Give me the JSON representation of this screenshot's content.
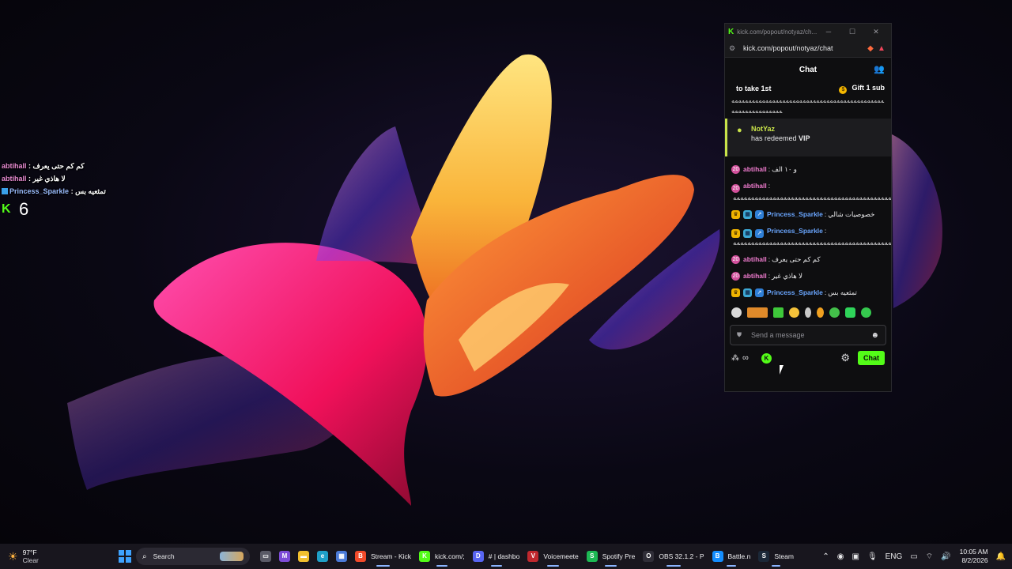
{
  "overlay": {
    "messages": [
      {
        "user": "abtihall",
        "text": "كم كم حتى يعرف"
      },
      {
        "user": "abtihall",
        "text": "لا هاذي غير"
      },
      {
        "user": "Princess_Sparkle",
        "text": "تمثعيه بس"
      }
    ],
    "viewer_count": "6"
  },
  "window": {
    "title": "kick.com/popout/notyaz/ch...",
    "url": "kick.com/popout/notyaz/chat",
    "controls": {
      "minimize": "─",
      "maximize": "☐",
      "close": "✕"
    }
  },
  "chat": {
    "header": "Chat",
    "pinned": {
      "left": "to take 1st",
      "gift": "Gift 1 sub"
    },
    "spam_top": "ﻪﻪﻪﻪﻪﻪﻪﻪﻪﻪﻪﻪﻪﻪﻪﻪﻪﻪﻪﻪﻪﻪﻪﻪﻪﻪﻪﻪﻪﻪﻪﻪﻪﻪﻪﻪﻪﻪﻪﻪﻪﻪﻪﻪﻪﻪﻪﻪﻪﻪﻪﻪﻪﻪﻪﻪﻪﻪﻪﻪ",
    "vip_event": {
      "user": "NotYaz",
      "text_prefix": "has redeemed ",
      "reward": "VIP"
    },
    "messages": [
      {
        "user": "abtihall",
        "text": "و ١٠ الف"
      },
      {
        "user": "abtihall",
        "text": "ﻪﻪﻪﻪﻪﻪﻪﻪﻪﻪﻪﻪﻪﻪﻪﻪﻪﻪﻪﻪﻪﻪﻪﻪﻪﻪﻪﻪﻪﻪﻪﻪﻪﻪﻪﻪﻪﻪﻪﻪﻪﻪﻪﻪﻪﻪﻪﻪﻪﻪ"
      },
      {
        "user": "Princess_Sparkle",
        "text": "خصوصيات شالي"
      },
      {
        "user": "Princess_Sparkle",
        "text": "ﻪﻪﻪﻪﻪﻪﻪﻪﻪﻪﻪﻪﻪﻪﻪﻪﻪﻪﻪﻪﻪﻪﻪﻪﻪﻪﻪﻪﻪﻪﻪﻪﻪﻪﻪﻪﻪﻪﻪﻪﻪﻪﻪﻪﻪﻪﻪﻪﻪﻪﻪﻪﻪ"
      },
      {
        "user": "abtihall",
        "text": "كم كم حتى يعرف"
      },
      {
        "user": "abtihall",
        "text": "لا هاذي غير"
      },
      {
        "user": "Princess_Sparkle",
        "text": "تمثعيه بس"
      }
    ],
    "input_placeholder": "Send a message",
    "send_label": "Chat",
    "badge_sub": "20"
  },
  "taskbar": {
    "weather": {
      "temp": "97°F",
      "condition": "Clear"
    },
    "search_label": "Search",
    "apps": [
      {
        "label": "",
        "name": "task-view",
        "color": "#5a5a66",
        "glyph": "▭"
      },
      {
        "label": "",
        "name": "m365",
        "color": "#7d4cd8",
        "glyph": "M"
      },
      {
        "label": "",
        "name": "file-explorer",
        "color": "#f2c02e",
        "glyph": "▬"
      },
      {
        "label": "",
        "name": "edge",
        "color": "#1fa0c8",
        "glyph": "e"
      },
      {
        "label": "",
        "name": "store",
        "color": "#4a7ad8",
        "glyph": "▦"
      },
      {
        "label": "Stream - Kick",
        "name": "brave-stream",
        "color": "#f24a2a",
        "glyph": "B"
      },
      {
        "label": "kick.com/;",
        "name": "kick",
        "color": "#53fc18",
        "glyph": "K"
      },
      {
        "label": "# | dashbo",
        "name": "discord",
        "color": "#5865f2",
        "glyph": "D"
      },
      {
        "label": "Voicemeete",
        "name": "voicemeeter",
        "color": "#c0282e",
        "glyph": "V"
      },
      {
        "label": "Spotify Pre",
        "name": "spotify",
        "color": "#1db954",
        "glyph": "S"
      },
      {
        "label": "OBS 32.1.2 - P",
        "name": "obs",
        "color": "#302e38",
        "glyph": "O"
      },
      {
        "label": "Battle.n",
        "name": "battlenet",
        "color": "#148eff",
        "glyph": "B"
      },
      {
        "label": "Steam",
        "name": "steam",
        "color": "#1b2838",
        "glyph": "S"
      }
    ],
    "lang": "ENG",
    "time": "10:05 AM",
    "date": "8/2/2026"
  }
}
